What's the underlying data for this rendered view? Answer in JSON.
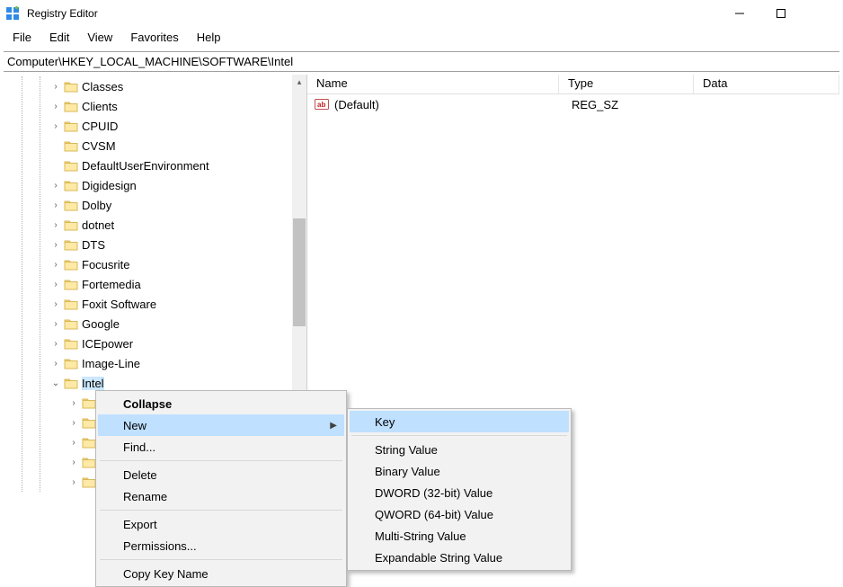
{
  "window": {
    "title": "Registry Editor"
  },
  "menu": {
    "file": "File",
    "edit": "Edit",
    "view": "View",
    "favorites": "Favorites",
    "help": "Help"
  },
  "address": "Computer\\HKEY_LOCAL_MACHINE\\SOFTWARE\\Intel",
  "tree": {
    "items": [
      {
        "label": "Classes",
        "expander": ">"
      },
      {
        "label": "Clients",
        "expander": ">"
      },
      {
        "label": "CPUID",
        "expander": ">"
      },
      {
        "label": "CVSM",
        "expander": ""
      },
      {
        "label": "DefaultUserEnvironment",
        "expander": ""
      },
      {
        "label": "Digidesign",
        "expander": ">"
      },
      {
        "label": "Dolby",
        "expander": ">"
      },
      {
        "label": "dotnet",
        "expander": ">"
      },
      {
        "label": "DTS",
        "expander": ">"
      },
      {
        "label": "Focusrite",
        "expander": ">"
      },
      {
        "label": "Fortemedia",
        "expander": ">"
      },
      {
        "label": "Foxit Software",
        "expander": ">"
      },
      {
        "label": "Google",
        "expander": ">"
      },
      {
        "label": "ICEpower",
        "expander": ">"
      },
      {
        "label": "Image-Line",
        "expander": ">"
      },
      {
        "label": "Intel",
        "expander": "v",
        "selected": true
      }
    ],
    "sub_expanders": [
      ">",
      ">",
      ">",
      ">",
      ">"
    ]
  },
  "list": {
    "columns": {
      "name": "Name",
      "type": "Type",
      "data": "Data"
    },
    "rows": [
      {
        "name": "(Default)",
        "type": "REG_SZ",
        "data": ""
      }
    ]
  },
  "context_main": {
    "collapse": "Collapse",
    "new": "New",
    "find": "Find...",
    "delete": "Delete",
    "rename": "Rename",
    "export": "Export",
    "permissions": "Permissions...",
    "copy_key_name": "Copy Key Name"
  },
  "context_new": {
    "key": "Key",
    "string": "String Value",
    "binary": "Binary Value",
    "dword": "DWORD (32-bit) Value",
    "qword": "QWORD (64-bit) Value",
    "multi": "Multi-String Value",
    "expand": "Expandable String Value"
  }
}
